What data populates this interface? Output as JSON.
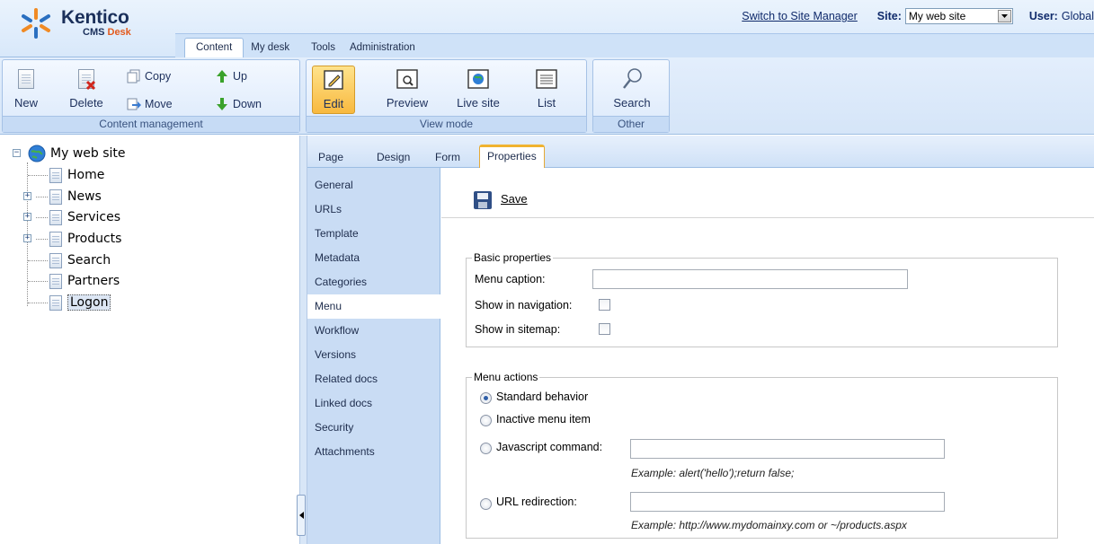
{
  "header": {
    "brand": "Kentico",
    "product_prefix": "CMS ",
    "product_suffix": "Desk",
    "switch_link": "Switch to Site Manager",
    "site_label": "Site:",
    "site_value": "My web site",
    "user_label": "User:",
    "user_value": "Global",
    "tabs": [
      "Content",
      "My desk",
      "Tools",
      "Administration"
    ],
    "active_tab": "Content"
  },
  "ribbon": {
    "content_management": {
      "caption": "Content management",
      "new": "New",
      "delete": "Delete",
      "copy": "Copy",
      "move": "Move",
      "up": "Up",
      "down": "Down"
    },
    "view_mode": {
      "caption": "View mode",
      "edit": "Edit",
      "preview": "Preview",
      "live_site": "Live site",
      "list": "List",
      "active": "Edit"
    },
    "other": {
      "caption": "Other",
      "search": "Search"
    }
  },
  "tree": {
    "root": "My web site",
    "items": [
      "Home",
      "News",
      "Services",
      "Products",
      "Search",
      "Partners",
      "Logon"
    ],
    "selected": "Logon"
  },
  "subtabs": [
    "Page",
    "Design",
    "Form",
    "Properties"
  ],
  "active_subtab": "Properties",
  "property_tabs": [
    "General",
    "URLs",
    "Template",
    "Metadata",
    "Categories",
    "Menu",
    "Workflow",
    "Versions",
    "Related docs",
    "Linked docs",
    "Security",
    "Attachments"
  ],
  "active_property_tab": "Menu",
  "save_label": "Save",
  "basic": {
    "legend": "Basic properties",
    "menu_caption_label": "Menu caption:",
    "menu_caption_value": "",
    "show_nav_label": "Show in navigation:",
    "show_nav_checked": false,
    "show_sitemap_label": "Show in sitemap:",
    "show_sitemap_checked": false
  },
  "actions": {
    "legend": "Menu actions",
    "standard": "Standard behavior",
    "inactive": "Inactive menu item",
    "javascript": "Javascript command:",
    "javascript_value": "",
    "javascript_example": "Example: alert('hello');return false;",
    "url": "URL redirection:",
    "url_value": "",
    "url_example": "Example: http://www.mydomainxy.com or ~/products.aspx",
    "selected": "Standard behavior"
  }
}
